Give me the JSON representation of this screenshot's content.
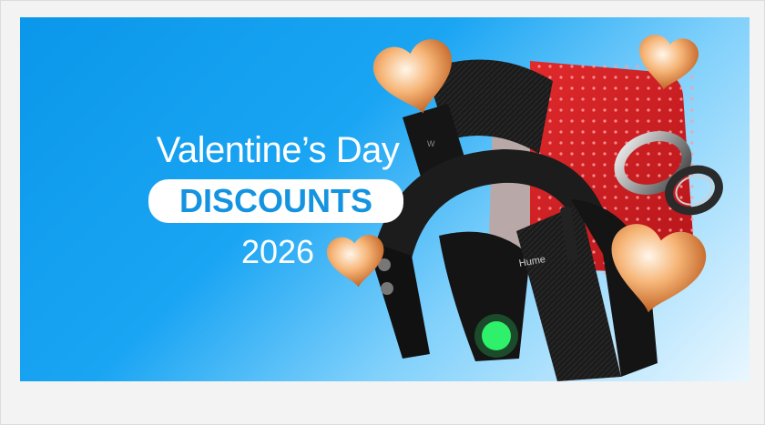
{
  "banner": {
    "title_line": "Valentine’s Day",
    "highlight": "DISCOUNTS",
    "year": "2026",
    "product_brand": "Hume",
    "colors": {
      "bg_start": "#0b97ea",
      "bg_end": "#e9f7ff",
      "pill_text": "#1494e0",
      "heart": "#f4a25a",
      "led_green": "#2ff06a",
      "red_pad": "#d81c20"
    }
  }
}
